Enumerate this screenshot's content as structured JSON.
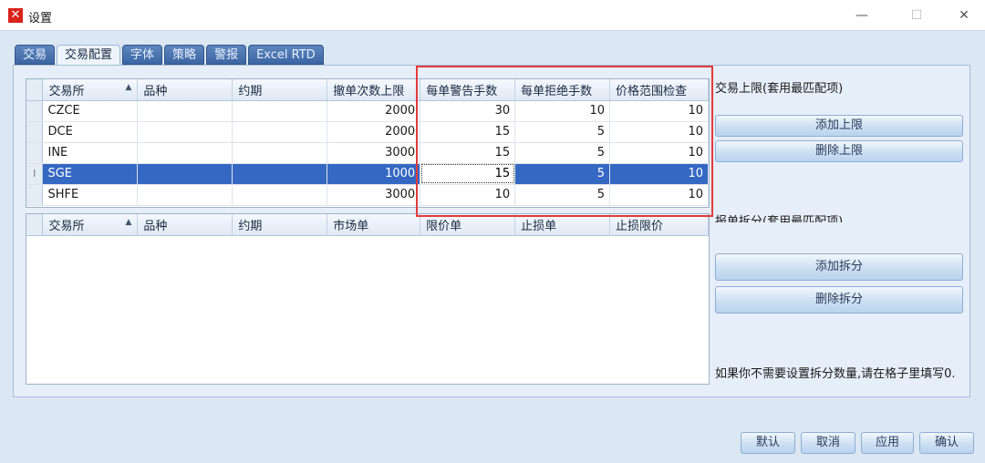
{
  "window": {
    "title": "设置",
    "app_icon": "x-logo-icon"
  },
  "tabs": [
    "交易",
    "交易配置",
    "字体",
    "策略",
    "警报",
    "Excel RTD"
  ],
  "active_tab": 1,
  "top_grid": {
    "columns": [
      "交易所",
      "品种",
      "约期",
      "撤单次数上限",
      "每单警告手数",
      "每单拒绝手数",
      "价格范围检查"
    ],
    "rows": [
      [
        "CZCE",
        "",
        "",
        "2000",
        "30",
        "10",
        "10"
      ],
      [
        "DCE",
        "",
        "",
        "2000",
        "15",
        "5",
        "10"
      ],
      [
        "INE",
        "",
        "",
        "3000",
        "15",
        "5",
        "10"
      ],
      [
        "SGE",
        "",
        "",
        "1000",
        "15",
        "5",
        "10"
      ],
      [
        "SHFE",
        "",
        "",
        "3000",
        "10",
        "5",
        "10"
      ]
    ],
    "selected_row": 3
  },
  "bottom_grid": {
    "columns": [
      "交易所",
      "品种",
      "约期",
      "市场单",
      "限价单",
      "止损单",
      "止损限价"
    ],
    "rows": []
  },
  "right": {
    "limit_label": "交易上限(套用最匹配项)",
    "add_limit": "添加上限",
    "del_limit": "删除上限",
    "split_label": "报单拆分(套用最匹配项)",
    "add_split": "添加拆分",
    "del_split": "删除拆分",
    "note": "如果你不需要设置拆分数量,请在格子里填写0."
  },
  "footer": {
    "default": "默认",
    "cancel": "取消",
    "apply": "应用",
    "ok": "确认"
  },
  "colors": {
    "highlight": "#e23b3b",
    "selection": "#3568c3"
  }
}
